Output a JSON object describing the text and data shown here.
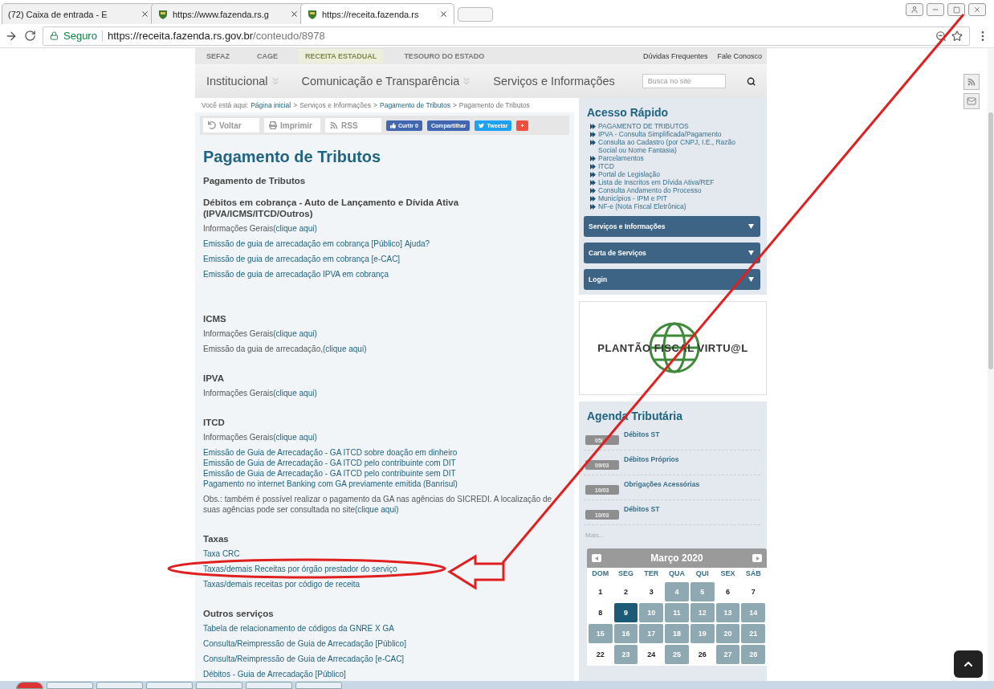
{
  "browser": {
    "tabs": [
      {
        "title": "(72) Caixa de entrada - E",
        "selected": false,
        "kind": "mail"
      },
      {
        "title": "https://www.fazenda.rs.g",
        "selected": false,
        "kind": "site"
      },
      {
        "title": "https://receita.fazenda.rs",
        "selected": true,
        "kind": "site"
      }
    ],
    "address": {
      "secure_label": "Seguro",
      "host": "https://receita.fazenda.rs.gov.br",
      "path": "/conteudo/8978"
    }
  },
  "site": {
    "top_links": [
      {
        "label": "SEFAZ",
        "selected": false
      },
      {
        "label": "CAGE",
        "selected": false
      },
      {
        "label": "RECEITA ESTADUAL",
        "selected": true
      },
      {
        "label": "TESOURO DO ESTADO",
        "selected": false
      }
    ],
    "utility_links": [
      "Dúvidas Frequentes",
      "Fale Conosco"
    ],
    "nav": [
      {
        "label": "Institucional",
        "has_menu": true
      },
      {
        "label": "Comunicação e Transparência",
        "has_menu": true
      },
      {
        "label": "Serviços e Informações",
        "has_menu": false
      }
    ],
    "search": {
      "placeholder": "Busca no site"
    }
  },
  "breadcrumb": {
    "prefix": "Você está aqui:",
    "separator": ">",
    "items": [
      {
        "label": "Página inicial",
        "link": true
      },
      {
        "label": "Serviços e Informações",
        "link": false
      },
      {
        "label": "Pagamento de Tributos",
        "link": true
      },
      {
        "label": "Pagamento de Tributos",
        "link": false
      }
    ]
  },
  "toolbar": [
    {
      "kind": "back",
      "label": "Voltar"
    },
    {
      "kind": "print",
      "label": "Imprimir"
    },
    {
      "kind": "rss",
      "label": "RSS"
    },
    {
      "kind": "like",
      "label": "Curtir 0"
    },
    {
      "kind": "share",
      "label": "Compartilhar"
    },
    {
      "kind": "tweet",
      "label": "Tweetar"
    },
    {
      "kind": "plus",
      "label": "+"
    }
  ],
  "title": "Pagamento de Tributos",
  "subtitle": "Pagamento de Tributos",
  "sections": [
    {
      "heading": "Débitos em cobrança - Auto de Lançamento e Dívida Ativa (IPVA/ICMS/ITCD/Outros)",
      "groups": [
        [
          [
            {
              "text": "Informações Gerais",
              "link": false
            },
            {
              "text": "(clique aqui)",
              "link": true
            }
          ]
        ],
        [
          [
            {
              "text": "Emissão de guia de arrecadação em cobrança [Público]",
              "link": true
            },
            {
              "text": "Ajuda?",
              "link": true
            }
          ]
        ],
        [
          [
            {
              "text": "Emissão de guia de arrecadação em cobrança [e-CAC]",
              "link": true
            }
          ]
        ],
        [
          [
            {
              "text": "Emissão de guia de arrecadação IPVA em cobrança",
              "link": true
            }
          ]
        ]
      ]
    },
    {
      "heading": "ICMS",
      "groups": [
        [
          [
            {
              "text": "Informações Gerais",
              "link": false
            },
            {
              "text": "(clique aqui)",
              "link": true
            }
          ]
        ],
        [
          [
            {
              "text": "Emissão da guia de arrecadação,",
              "link": false
            },
            {
              "text": "(clique aqui)",
              "link": true
            }
          ]
        ]
      ]
    },
    {
      "heading": "IPVA",
      "groups": [
        [
          [
            {
              "text": "Informações Gerais",
              "link": false
            },
            {
              "text": "(clique aqui)",
              "link": true
            }
          ]
        ]
      ]
    },
    {
      "heading": "ITCD",
      "groups": [
        [
          [
            {
              "text": "Informações Gerais",
              "link": false
            },
            {
              "text": "(clique aqui)",
              "link": true
            }
          ]
        ],
        [
          [
            {
              "text": "Emissão de Guia de Arrecadação - GA ITCD sobre doação em dinheiro",
              "link": true
            }
          ],
          [
            {
              "text": "Emissão de Guia de Arrecadação - GA ITCD pelo contribuinte com DIT",
              "link": true
            }
          ],
          [
            {
              "text": "Emissão de Guia de Arrecadação - GA ITCD pelo contribuinte sem DIT",
              "link": true
            }
          ],
          [
            {
              "text": "Pagamento no internet Banking com GA previamente emitida (Banrisul)",
              "link": true
            }
          ]
        ],
        [
          [
            {
              "text": "Obs.: também é possível realizar o pagamento da GA nas agências do SICREDI. A localização de suas agências pode ser consultada no site",
              "link": false
            },
            {
              "text": "(clique aqui)",
              "link": true
            }
          ]
        ]
      ]
    },
    {
      "heading": "Taxas",
      "groups": [
        [
          [
            {
              "text": "Taxa CRC",
              "link": true
            }
          ]
        ],
        [
          [
            {
              "text": "Taxas/demais Receitas por órgão prestador do serviço",
              "link": true
            }
          ]
        ],
        [
          [
            {
              "text": "Taxas/demais receitas por código de receita",
              "link": true
            }
          ]
        ]
      ]
    },
    {
      "heading": "Outros serviços",
      "groups": [
        [
          [
            {
              "text": "Tabela de relacionamento de códigos da GNRE X GA",
              "link": true
            }
          ]
        ],
        [
          [
            {
              "text": "Consulta/Reimpressão de Guia de Arrecadação [Público]",
              "link": true
            }
          ]
        ],
        [
          [
            {
              "text": "Consulta/Reimpressão de Guia de Arrecadação [e-CAC]",
              "link": true
            }
          ]
        ],
        [
          [
            {
              "text": "Débitos - Guia de Arrecadação [Público]",
              "link": true
            }
          ]
        ]
      ]
    }
  ],
  "quick_access": {
    "title": "Acesso Rápido",
    "items": [
      "PAGAMENTO DE TRIBUTOS",
      "IPVA - Consulta Simplificada/Pagamento",
      "Consulta ao Cadastro (por CNPJ, I.E., Razão Social ou Nome Fantasia)",
      "Parcelamentos",
      "ITCD",
      "Portal de Legislação",
      "Lista de Inscritos em Dívida Ativa/REF",
      "Consulta Andamento do Processo",
      "Municípios - IPM e PIT",
      "NF-e (Nota Fiscal Eletrônica)"
    ]
  },
  "accordions": [
    {
      "label": "Serviços e Informações",
      "expanded": false
    },
    {
      "label": "Carta de Serviços",
      "expanded": false
    },
    {
      "label": "Login",
      "expanded": false
    }
  ],
  "banner": {
    "text": "PLANTÃO FISCAL VIRTU@L"
  },
  "agenda": {
    "title": "Agenda Tributária",
    "events": [
      {
        "date": "05/",
        "label": "Débitos ST"
      },
      {
        "date": "09/03",
        "label": "Débitos Próprios"
      },
      {
        "date": "10/03",
        "label": "Obrigações Acessórias"
      },
      {
        "date": "10/03",
        "label": "Débitos ST"
      }
    ],
    "more": "Mais..."
  },
  "calendar": {
    "month": "Março 2020",
    "weekdays": [
      "DOM",
      "SEG",
      "TER",
      "QUA",
      "QUI",
      "SEX",
      "SÁB"
    ],
    "weeks": [
      [
        {
          "day": "1",
          "kind": "plain"
        },
        {
          "day": "2",
          "kind": "plain"
        },
        {
          "day": "3",
          "kind": "plain"
        },
        {
          "day": "4",
          "kind": "event"
        },
        {
          "day": "5",
          "kind": "event"
        },
        {
          "day": "6",
          "kind": "plain"
        },
        {
          "day": "7",
          "kind": "plain"
        }
      ],
      [
        {
          "day": "8",
          "kind": "plain"
        },
        {
          "day": "9",
          "kind": "today"
        },
        {
          "day": "10",
          "kind": "event"
        },
        {
          "day": "11",
          "kind": "event"
        },
        {
          "day": "12",
          "kind": "event"
        },
        {
          "day": "13",
          "kind": "event"
        },
        {
          "day": "14",
          "kind": "event"
        }
      ],
      [
        {
          "day": "15",
          "kind": "event"
        },
        {
          "day": "16",
          "kind": "event"
        },
        {
          "day": "17",
          "kind": "event"
        },
        {
          "day": "18",
          "kind": "event"
        },
        {
          "day": "19",
          "kind": "event"
        },
        {
          "day": "20",
          "kind": "event"
        },
        {
          "day": "21",
          "kind": "event"
        }
      ],
      [
        {
          "day": "22",
          "kind": "plain"
        },
        {
          "day": "23",
          "kind": "event"
        },
        {
          "day": "24",
          "kind": "plain"
        },
        {
          "day": "25",
          "kind": "event"
        },
        {
          "day": "26",
          "kind": "plain"
        },
        {
          "day": "27",
          "kind": "event"
        },
        {
          "day": "28",
          "kind": "event"
        }
      ]
    ]
  },
  "annotations": {
    "ellipse": true,
    "arrow": true
  },
  "taskbar": [
    {
      "kind": "start"
    },
    {
      "kind": "app"
    },
    {
      "kind": "app"
    },
    {
      "kind": "app"
    },
    {
      "kind": "app"
    },
    {
      "kind": "app"
    },
    {
      "kind": "app"
    }
  ]
}
